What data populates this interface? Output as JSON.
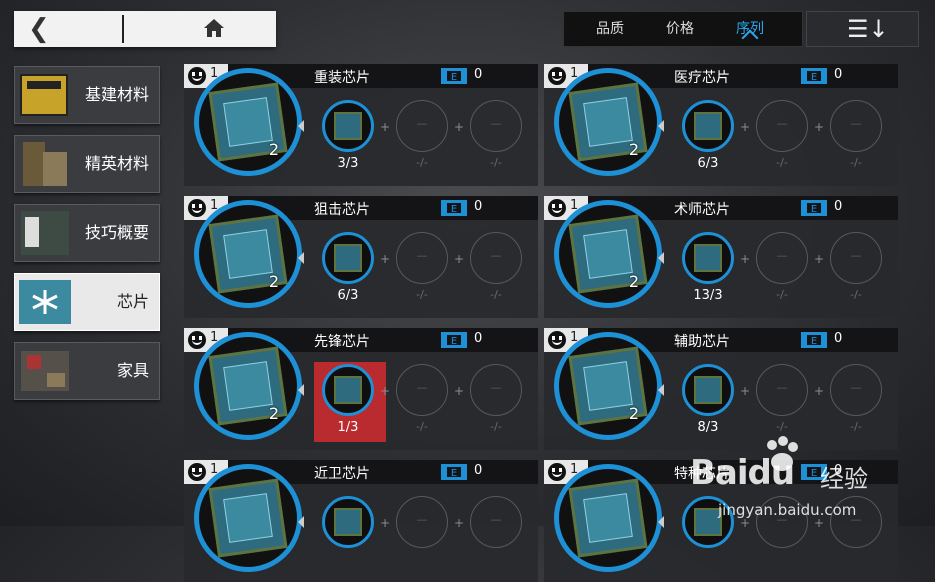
{
  "topbar": {
    "back_icon": "back-arrow-icon",
    "home_icon": "home-icon",
    "sort_tabs": [
      {
        "label": "品质",
        "active": false
      },
      {
        "label": "价格",
        "active": false
      },
      {
        "label": "序列",
        "active": true
      }
    ],
    "order_icon": "sort-order-icon",
    "accent_color": "#29a9f0"
  },
  "sidebar": {
    "items": [
      {
        "label": "基建材料",
        "active": false
      },
      {
        "label": "精英材料",
        "active": false
      },
      {
        "label": "技巧概要",
        "active": false
      },
      {
        "label": "芯片",
        "active": true
      },
      {
        "label": "家具",
        "active": false
      }
    ]
  },
  "cards": [
    {
      "owned": "1",
      "name": "重装芯片",
      "tickets": "0",
      "count": "2",
      "slot1": "3/3",
      "slot2": "-/-",
      "slot3": "-/-",
      "highlight": false
    },
    {
      "owned": "1",
      "name": "医疗芯片",
      "tickets": "0",
      "count": "2",
      "slot1": "6/3",
      "slot2": "-/-",
      "slot3": "-/-",
      "highlight": false
    },
    {
      "owned": "1",
      "name": "狙击芯片",
      "tickets": "0",
      "count": "2",
      "slot1": "6/3",
      "slot2": "-/-",
      "slot3": "-/-",
      "highlight": false
    },
    {
      "owned": "1",
      "name": "术师芯片",
      "tickets": "0",
      "count": "2",
      "slot1": "13/3",
      "slot2": "-/-",
      "slot3": "-/-",
      "highlight": false
    },
    {
      "owned": "1",
      "name": "先锋芯片",
      "tickets": "0",
      "count": "2",
      "slot1": "1/3",
      "slot2": "-/-",
      "slot3": "-/-",
      "highlight": true
    },
    {
      "owned": "1",
      "name": "辅助芯片",
      "tickets": "0",
      "count": "2",
      "slot1": "8/3",
      "slot2": "-/-",
      "slot3": "-/-",
      "highlight": false
    },
    {
      "owned": "1",
      "name": "近卫芯片",
      "tickets": "0",
      "count": "",
      "slot1": "",
      "slot2": "",
      "slot3": "",
      "highlight": false
    },
    {
      "owned": "1",
      "name": "特种芯片",
      "tickets": "0",
      "count": "",
      "slot1": "",
      "slot2": "",
      "slot3": "",
      "highlight": false
    }
  ],
  "slot_empty_glyph": "—",
  "watermark": {
    "brand": "Baidu",
    "suffix": "经验",
    "url": "jingyan.baidu.com"
  }
}
